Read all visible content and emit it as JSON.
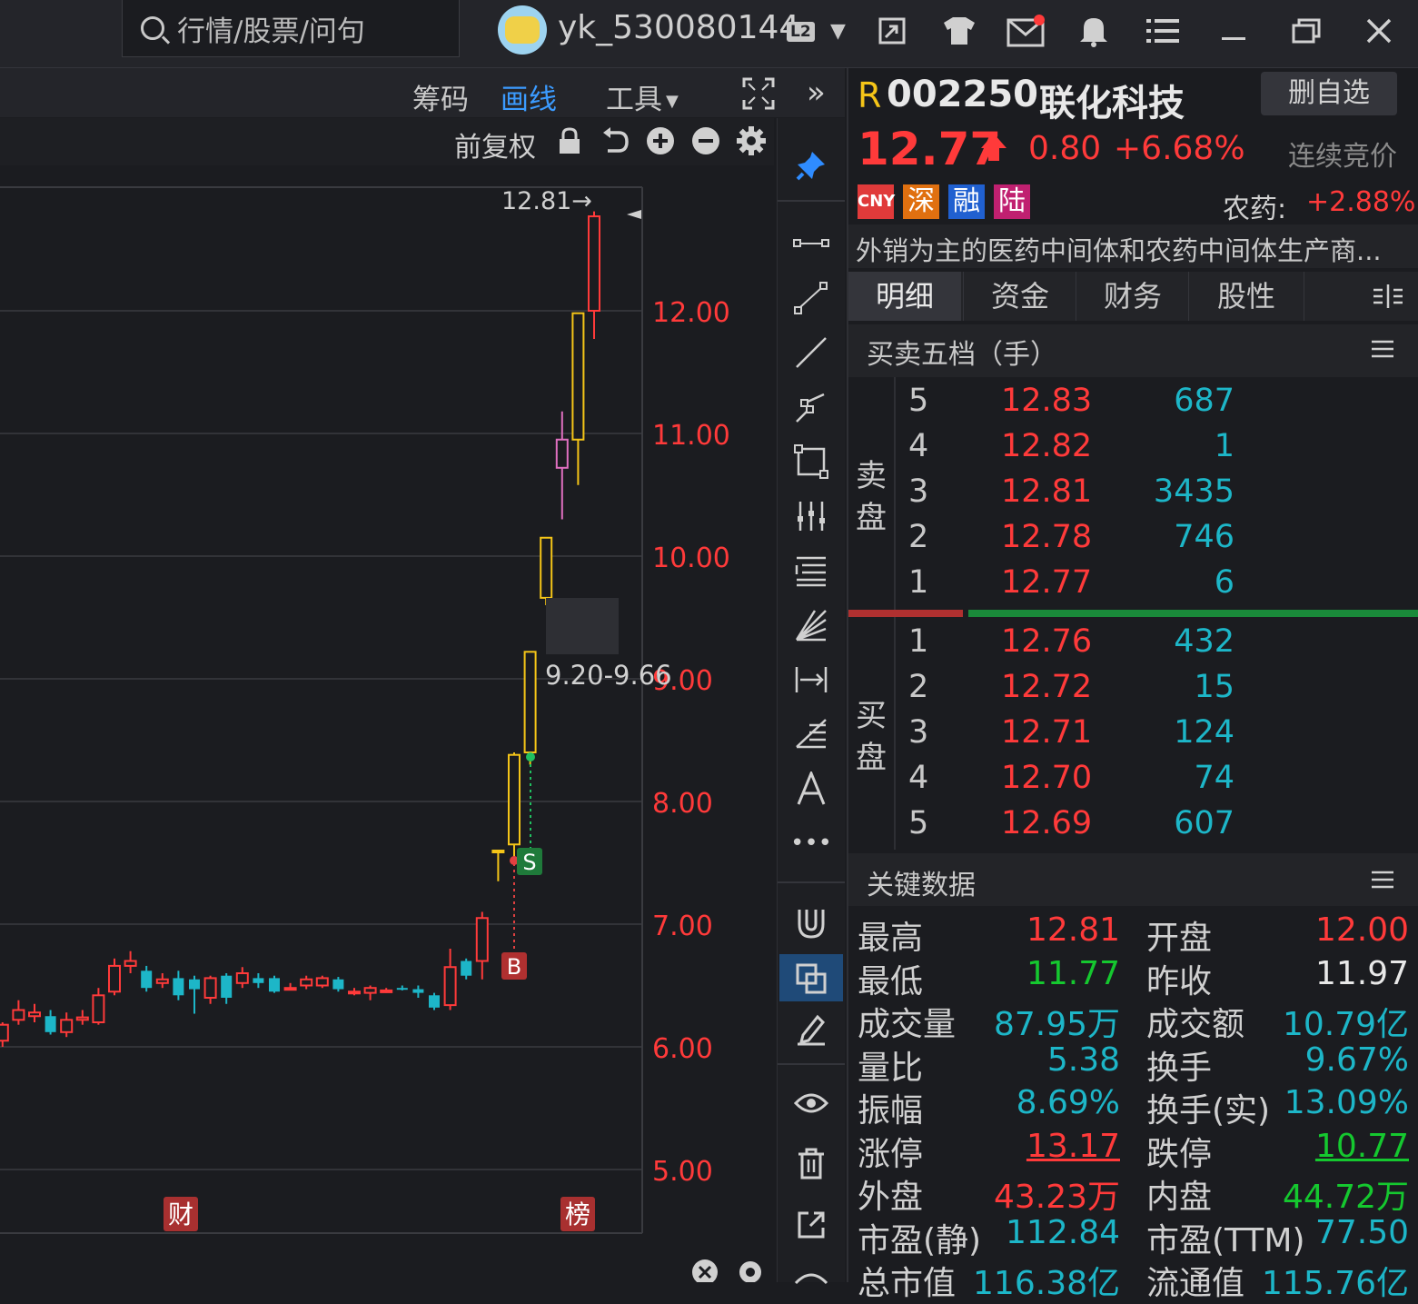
{
  "topbar": {
    "search_placeholder": "行情/股票/问句",
    "username": "yk_530080144",
    "level_badge": "L2",
    "icons": [
      "restore-window-icon",
      "shirt-icon",
      "mail-icon",
      "bell-icon",
      "list-icon",
      "minimize-icon",
      "maximize-icon",
      "close-icon"
    ]
  },
  "chart_header": {
    "tabs": [
      "筹码",
      "画线",
      "工具"
    ],
    "active_tab": "画线",
    "adjust": "前复权"
  },
  "chart": {
    "high_label": "12.81→",
    "range_label": "9.20-9.66",
    "y_ticks": [
      "12.00",
      "11.00",
      "10.00",
      "9.00",
      "8.00",
      "7.00",
      "6.00",
      "5.00"
    ],
    "markers": {
      "sell": "S",
      "buy": "B"
    },
    "bottom_tags": [
      "财",
      "榜"
    ],
    "colors": {
      "up": "#ff3a3a",
      "down": "#1db6c8",
      "limit": "#f5c518",
      "highlight": "#e070c0",
      "grid": "#3a3b40",
      "axis_text": "#ff3a3a"
    }
  },
  "chart_data": {
    "type": "candlestick",
    "y_ticks": [
      5,
      6,
      7,
      8,
      9,
      10,
      11,
      12
    ],
    "candles": [
      {
        "o": 6.1,
        "h": 6.22,
        "l": 6.02,
        "c": 6.15
      },
      {
        "o": 6.05,
        "h": 6.2,
        "l": 6.0,
        "c": 6.18
      },
      {
        "o": 6.22,
        "h": 6.38,
        "l": 6.18,
        "c": 6.3
      },
      {
        "o": 6.25,
        "h": 6.35,
        "l": 6.2,
        "c": 6.28
      },
      {
        "o": 6.25,
        "h": 6.3,
        "l": 6.1,
        "c": 6.12
      },
      {
        "o": 6.12,
        "h": 6.28,
        "l": 6.08,
        "c": 6.22
      },
      {
        "o": 6.22,
        "h": 6.3,
        "l": 6.18,
        "c": 6.24
      },
      {
        "o": 6.2,
        "h": 6.48,
        "l": 6.18,
        "c": 6.42
      },
      {
        "o": 6.45,
        "h": 6.72,
        "l": 6.42,
        "c": 6.66
      },
      {
        "o": 6.66,
        "h": 6.78,
        "l": 6.6,
        "c": 6.7
      },
      {
        "o": 6.62,
        "h": 6.66,
        "l": 6.45,
        "c": 6.48
      },
      {
        "o": 6.52,
        "h": 6.6,
        "l": 6.48,
        "c": 6.55
      },
      {
        "o": 6.56,
        "h": 6.62,
        "l": 6.38,
        "c": 6.42
      },
      {
        "o": 6.55,
        "h": 6.58,
        "l": 6.27,
        "c": 6.47
      },
      {
        "o": 6.4,
        "h": 6.58,
        "l": 6.35,
        "c": 6.56
      },
      {
        "o": 6.58,
        "h": 6.6,
        "l": 6.35,
        "c": 6.4
      },
      {
        "o": 6.52,
        "h": 6.65,
        "l": 6.48,
        "c": 6.6
      },
      {
        "o": 6.56,
        "h": 6.6,
        "l": 6.48,
        "c": 6.52
      },
      {
        "o": 6.56,
        "h": 6.58,
        "l": 6.44,
        "c": 6.45
      },
      {
        "o": 6.48,
        "h": 6.52,
        "l": 6.46,
        "c": 6.48
      },
      {
        "o": 6.5,
        "h": 6.58,
        "l": 6.47,
        "c": 6.55
      },
      {
        "o": 6.5,
        "h": 6.58,
        "l": 6.48,
        "c": 6.56
      },
      {
        "o": 6.55,
        "h": 6.57,
        "l": 6.45,
        "c": 6.47
      },
      {
        "o": 6.45,
        "h": 6.48,
        "l": 6.42,
        "c": 6.45
      },
      {
        "o": 6.44,
        "h": 6.5,
        "l": 6.38,
        "c": 6.48
      },
      {
        "o": 6.46,
        "h": 6.48,
        "l": 6.44,
        "c": 6.46
      },
      {
        "o": 6.48,
        "h": 6.5,
        "l": 6.46,
        "c": 6.47
      },
      {
        "o": 6.47,
        "h": 6.5,
        "l": 6.4,
        "c": 6.44
      },
      {
        "o": 6.42,
        "h": 6.44,
        "l": 6.3,
        "c": 6.32
      },
      {
        "o": 6.34,
        "h": 6.8,
        "l": 6.3,
        "c": 6.65
      },
      {
        "o": 6.7,
        "h": 6.72,
        "l": 6.55,
        "c": 6.58
      },
      {
        "o": 6.7,
        "h": 7.1,
        "l": 6.55,
        "c": 7.05
      },
      {
        "o": 7.6,
        "h": 7.6,
        "l": 7.35,
        "c": 7.6
      },
      {
        "o": 7.65,
        "h": 8.4,
        "l": 7.55,
        "c": 8.38
      },
      {
        "o": 8.4,
        "h": 9.22,
        "l": 8.3,
        "c": 9.22
      },
      {
        "o": 9.66,
        "h": 10.15,
        "l": 9.6,
        "c": 10.15
      },
      {
        "o": 10.95,
        "h": 11.18,
        "l": 10.3,
        "c": 10.72
      },
      {
        "o": 10.95,
        "h": 11.98,
        "l": 10.58,
        "c": 11.98
      },
      {
        "o": 12.0,
        "h": 12.81,
        "l": 11.77,
        "c": 12.77
      }
    ]
  },
  "quote": {
    "prefix": "R",
    "code": "002250",
    "name": "联化科技",
    "remove_fav": "删自选",
    "price": "12.77",
    "change": "0.80",
    "change_pct": "+6.68%",
    "status": "连续竞价",
    "tags": [
      "CNY",
      "深",
      "融",
      "陆"
    ],
    "sector": "农药:",
    "sector_pct": "+2.88%",
    "desc": "外销为主的医药中间体和农药中间体生产商..."
  },
  "tabs": [
    "明细",
    "资金",
    "财务",
    "股性"
  ],
  "orderbook": {
    "title": "买卖五档（手）",
    "sell_label": [
      "卖",
      "盘"
    ],
    "buy_label": [
      "买",
      "盘"
    ],
    "sells": [
      {
        "lvl": "5",
        "price": "12.83",
        "vol": "687"
      },
      {
        "lvl": "4",
        "price": "12.82",
        "vol": "1"
      },
      {
        "lvl": "3",
        "price": "12.81",
        "vol": "3435"
      },
      {
        "lvl": "2",
        "price": "12.78",
        "vol": "746"
      },
      {
        "lvl": "1",
        "price": "12.77",
        "vol": "6"
      }
    ],
    "buys": [
      {
        "lvl": "1",
        "price": "12.76",
        "vol": "432"
      },
      {
        "lvl": "2",
        "price": "12.72",
        "vol": "15"
      },
      {
        "lvl": "3",
        "price": "12.71",
        "vol": "124"
      },
      {
        "lvl": "4",
        "price": "12.70",
        "vol": "74"
      },
      {
        "lvl": "5",
        "price": "12.69",
        "vol": "607"
      }
    ]
  },
  "keydata": {
    "title": "关键数据",
    "rows": [
      {
        "l1": "最高",
        "v1": "12.81",
        "c1": "red",
        "l2": "开盘",
        "v2": "12.00",
        "c2": "red"
      },
      {
        "l1": "最低",
        "v1": "11.77",
        "c1": "grn",
        "l2": "昨收",
        "v2": "11.97",
        "c2": "wht"
      },
      {
        "l1": "成交量",
        "v1": "87.95万",
        "c1": "cyan",
        "l2": "成交额",
        "v2": "10.79亿",
        "c2": "cyan"
      },
      {
        "l1": "量比",
        "v1": "5.38",
        "c1": "cyan",
        "l2": "换手",
        "v2": "9.67%",
        "c2": "cyan"
      },
      {
        "l1": "振幅",
        "v1": "8.69%",
        "c1": "cyan",
        "l2": "换手(实)",
        "v2": "13.09%",
        "c2": "cyan"
      },
      {
        "l1": "涨停",
        "v1": "13.17",
        "c1": "red",
        "l2": "跌停",
        "v2": "10.77",
        "c2": "grn"
      },
      {
        "l1": "外盘",
        "v1": "43.23万",
        "c1": "red",
        "l2": "内盘",
        "v2": "44.72万",
        "c2": "grn"
      },
      {
        "l1": "市盈(静)",
        "v1": "112.84",
        "c1": "cyan",
        "l2": "市盈(TTM)",
        "v2": "77.50",
        "c2": "cyan"
      },
      {
        "l1": "总市值",
        "v1": "116.38亿",
        "c1": "cyan",
        "l2": "流通值",
        "v2": "115.76亿",
        "c2": "cyan"
      }
    ]
  }
}
